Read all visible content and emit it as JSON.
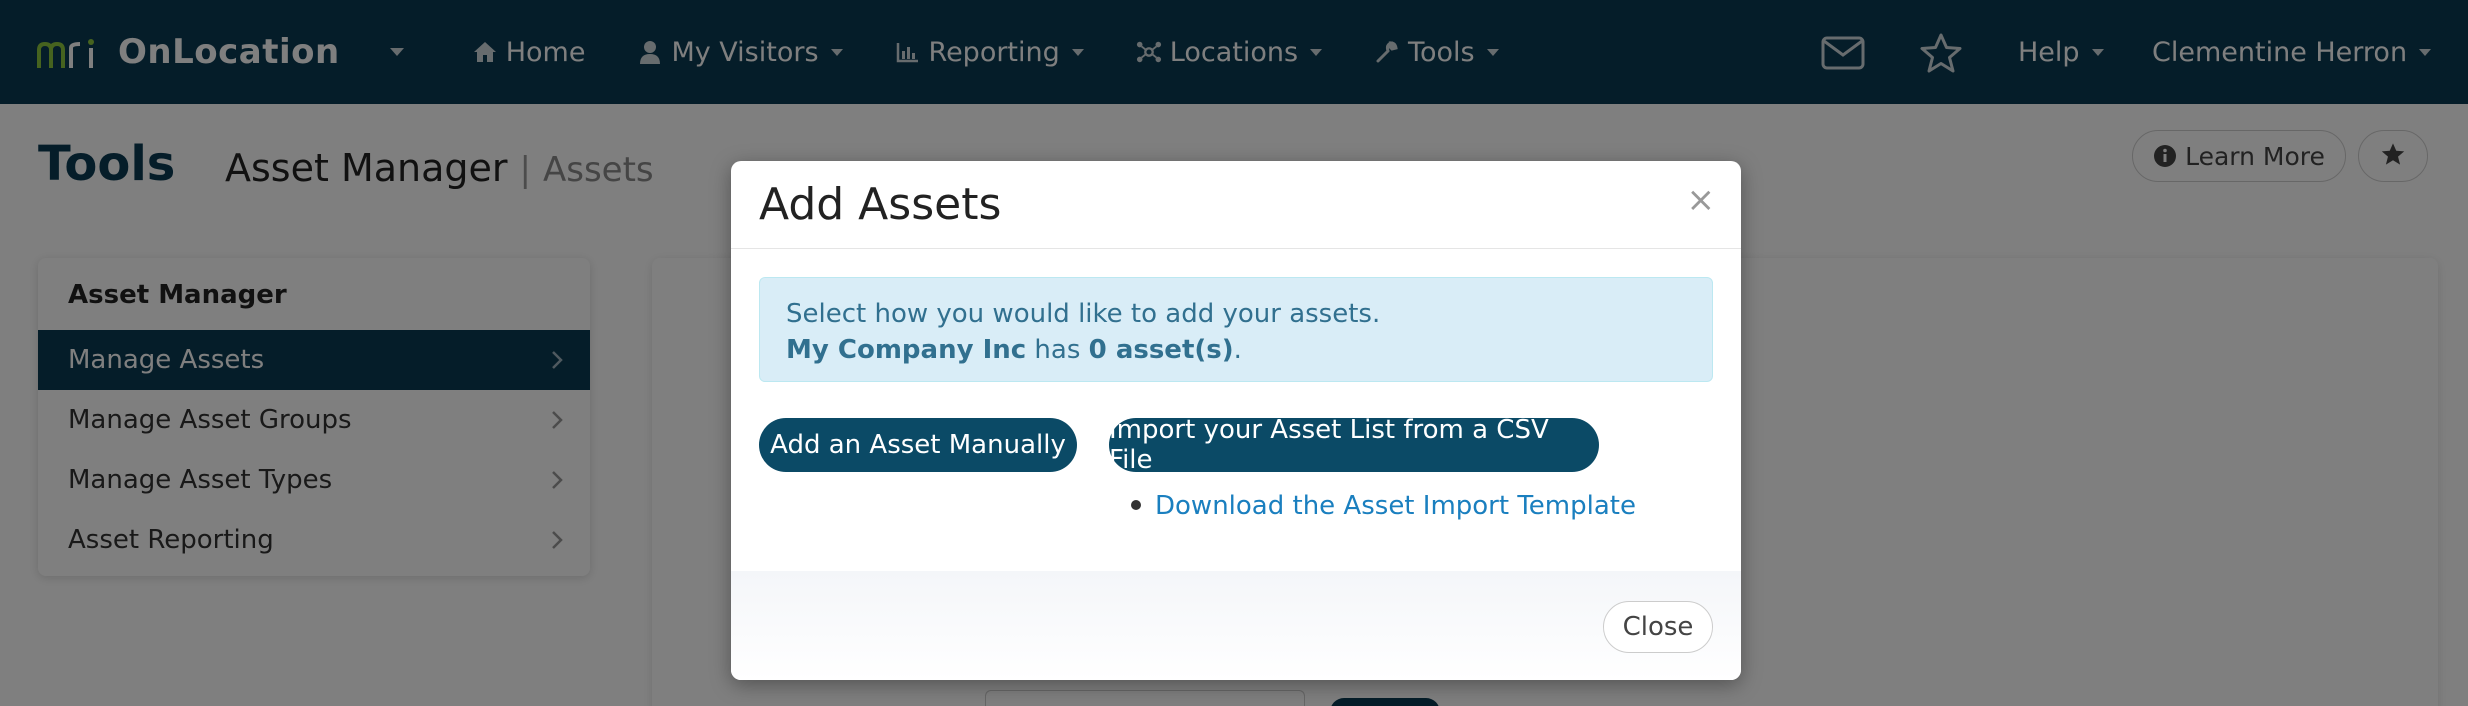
{
  "navbar": {
    "brand_logo_text": "mri",
    "brand_name": "OnLocation",
    "items": [
      {
        "label": "Home",
        "icon": "home-icon"
      },
      {
        "label": "My Visitors",
        "icon": "user-icon"
      },
      {
        "label": "Reporting",
        "icon": "bar-chart-icon"
      },
      {
        "label": "Locations",
        "icon": "network-icon"
      },
      {
        "label": "Tools",
        "icon": "wrench-icon"
      }
    ],
    "help_label": "Help",
    "user_label": "Clementine Herron"
  },
  "page": {
    "title": "Tools",
    "subtitle": "Asset Manager",
    "separator": "|",
    "breadcrumb": "Assets",
    "learn_more_label": "Learn More"
  },
  "sidebar": {
    "header": "Asset Manager",
    "items": [
      {
        "label": "Manage Assets",
        "active": true
      },
      {
        "label": "Manage Asset Groups",
        "active": false
      },
      {
        "label": "Manage Asset Types",
        "active": false
      },
      {
        "label": "Asset Reporting",
        "active": false
      }
    ]
  },
  "modal": {
    "title": "Add Assets",
    "close_x": "×",
    "alert_line1": "Select how you would like to add your assets.",
    "company": "My Company Inc",
    "has_text": " has ",
    "asset_count": "0 asset(s)",
    "period": ".",
    "add_manually_label": "Add an Asset Manually",
    "import_csv_label": "Import your Asset List from a CSV File",
    "template_link": "Download the Asset Import Template",
    "close_label": "Close"
  },
  "colors": {
    "navbar": "#0b3a52",
    "primary_button": "#0b4a66",
    "alert_bg": "#d9edf7",
    "alert_text": "#31708f",
    "link": "#1a7fbf"
  }
}
